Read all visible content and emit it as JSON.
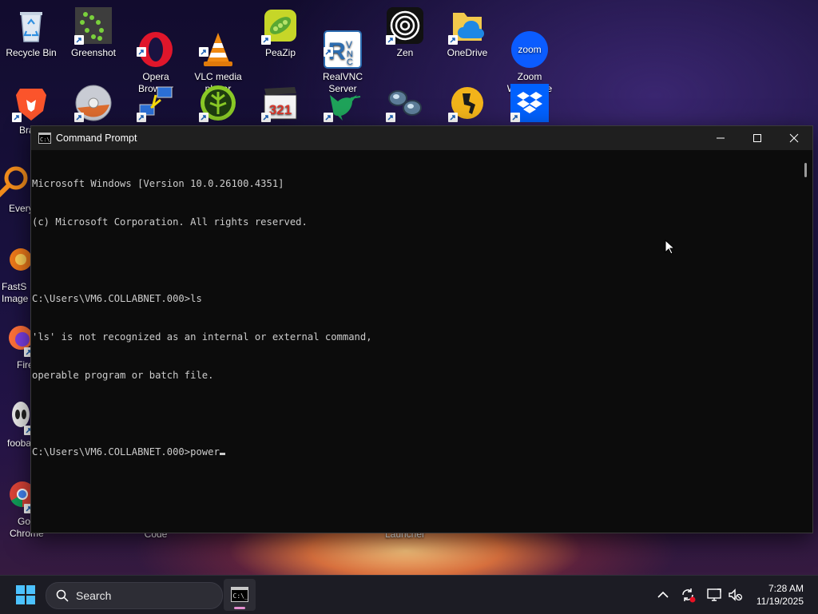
{
  "desktop": {
    "row1": [
      {
        "name": "recycle-bin",
        "label": "Recycle Bin"
      },
      {
        "name": "greenshot",
        "label": "Greenshot"
      },
      {
        "name": "opera",
        "label": "Opera\nBrowser"
      },
      {
        "name": "vlc",
        "label": "VLC media\nplayer"
      },
      {
        "name": "peazip",
        "label": "PeaZip"
      },
      {
        "name": "realvnc",
        "label": "RealVNC\nServer"
      },
      {
        "name": "zen",
        "label": "Zen"
      },
      {
        "name": "onedrive",
        "label": "OneDrive"
      },
      {
        "name": "zoom",
        "label": "Zoom\nWorkplace"
      }
    ],
    "left_column_partial": [
      {
        "label": "Bra"
      },
      {
        "label": "Every"
      },
      {
        "label": "FastS\nImage"
      },
      {
        "label": "Fire"
      },
      {
        "label": "fooba"
      },
      {
        "label": "Goo\nChrome"
      }
    ],
    "bottom_partial": [
      {
        "label": "Code"
      },
      {
        "label": "Launcher"
      }
    ]
  },
  "cmd_window": {
    "title": "Command Prompt",
    "lines": [
      "Microsoft Windows [Version 10.0.26100.4351]",
      "(c) Microsoft Corporation. All rights reserved.",
      "",
      "C:\\Users\\VM6.COLLABNET.000>ls",
      "'ls' is not recognized as an internal or external command,",
      "operable program or batch file.",
      ""
    ],
    "prompt": "C:\\Users\\VM6.COLLABNET.000>",
    "current_input": "power"
  },
  "taskbar": {
    "search_placeholder": "Search",
    "time": "7:28 AM",
    "date": "11/19/2025"
  },
  "colors": {
    "accent": "#0078d4",
    "cmd_bg": "#0c0c0c",
    "cmd_text": "#cccccc"
  }
}
